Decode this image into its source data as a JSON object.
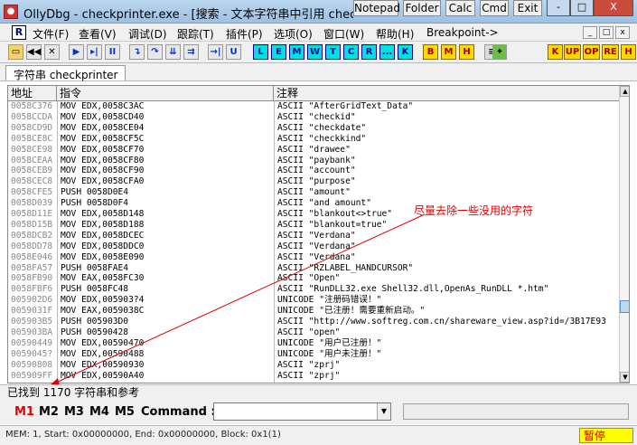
{
  "title": "OllyDbg - checkprinter.exe - [搜索 - 文本字符串中引用 checkprinter]",
  "external_buttons": [
    "Notepad",
    "Folder",
    "Calc",
    "Cmd",
    "Exit"
  ],
  "window_controls": {
    "minimize": "-",
    "maximize": "□",
    "close": "X"
  },
  "app_icon": "ollydbg-bug-icon",
  "menu": {
    "r_icon": "R",
    "items": [
      "文件(F)",
      "查看(V)",
      "调试(D)",
      "跟踪(T)",
      "插件(P)",
      "选项(O)",
      "窗口(W)",
      "帮助(H)",
      "Breakpoint->"
    ],
    "mdi_controls": [
      "_",
      "□",
      "x"
    ]
  },
  "toolbar": {
    "buttons": [
      "open",
      "rewind",
      "close",
      "run",
      "pause-run",
      "pause",
      "step-into",
      "step-over",
      "trace-into",
      "trace-over",
      "execute-till-return",
      "go-to-user"
    ],
    "letter_buttons": [
      "L",
      "E",
      "M",
      "W",
      "T",
      "C",
      "R",
      "...",
      "K"
    ],
    "letter_buttons2": [
      "B",
      "M",
      "H"
    ],
    "right_buttons": [
      "K",
      "UP",
      "OP",
      "RE",
      "H"
    ]
  },
  "tab": {
    "label": "字符串 checkprinter"
  },
  "table": {
    "headers": [
      "地址",
      "指令",
      "注释"
    ],
    "rows": [
      [
        "0058C376",
        "MOV EDX,0058C3AC",
        "ASCII \"AfterGridText_Data\""
      ],
      [
        "0058CCDA",
        "MOV EDX,0058CD40",
        "ASCII \"checkid\""
      ],
      [
        "0058CD9D",
        "MOV EDX,0058CE04",
        "ASCII \"checkdate\""
      ],
      [
        "0058CE8C",
        "MOV EDX,0058CF5C",
        "ASCII \"checkkind\""
      ],
      [
        "0058CE98",
        "MOV EDX,0058CF70",
        "ASCII \"drawee\""
      ],
      [
        "0058CEAA",
        "MOV EDX,0058CF80",
        "ASCII \"paybank\""
      ],
      [
        "0058CEB9",
        "MOV EDX,0058CF90",
        "ASCII \"account\""
      ],
      [
        "0058CEC8",
        "MOV EDX,0058CFA0",
        "ASCII \"purpose\""
      ],
      [
        "0058CFE5",
        "PUSH 0058D0E4",
        "ASCII \"amount\""
      ],
      [
        "0058D039",
        "PUSH 0058D0F4",
        "ASCII \"and amount\""
      ],
      [
        "0058D11E",
        "MOV EDX,0058D148",
        "ASCII \"blankout<>true\""
      ],
      [
        "0058D15B",
        "MOV EDX,0058D188",
        "ASCII \"blankout=true\""
      ],
      [
        "0058DCB2",
        "MOV EDX,0058DCEC",
        "ASCII \"Verdana\""
      ],
      [
        "0058DD78",
        "MOV EDX,0058DDC0",
        "ASCII \"Verdana\""
      ],
      [
        "0058E046",
        "MOV EDX,0058E090",
        "ASCII \"Verdana\""
      ],
      [
        "0058FA57",
        "PUSH 0058FAE4",
        "ASCII \"RZLABEL_HANDCURSOR\""
      ],
      [
        "0058FB90",
        "MOV EAX,0058FC30",
        "ASCII \"Open\""
      ],
      [
        "0058FBF6",
        "PUSH 0058FC48",
        "ASCII \"RunDLL32.exe Shell32.dll,OpenAs_RunDLL *.htm\""
      ],
      [
        "005902D6",
        "MOV EDX,005903?4",
        "UNICODE \"注册码错误！\""
      ],
      [
        "0059031F",
        "MOV EAX,0059038C",
        "UNICODE \"已注册！需要重新启动。\""
      ],
      [
        "005903B5",
        "PUSH 005903D0",
        "ASCII \"http://www.softreg.com.cn/shareware_view.asp?id=/3B17E93"
      ],
      [
        "005903BA",
        "PUSH 00590428",
        "ASCII \"open\""
      ],
      [
        "00590449",
        "MOV EDX,00590470",
        "UNICODE \"用户已注册！\""
      ],
      [
        "0059045?",
        "MOV EDX,00590488",
        "UNICODE \"用户未注册！\""
      ],
      [
        "00590808",
        "MOV EDX,00590930",
        "ASCII \"zprj\""
      ],
      [
        "005909FF",
        "MOV EDX,00590A40",
        "ASCII \"zprj\""
      ]
    ]
  },
  "annotation": "尽量去除一些没用的字符",
  "status_found": "已找到 1170 字符串和参考",
  "command_bar": {
    "m_buttons": [
      "M1",
      "M2",
      "M3",
      "M4",
      "M5"
    ],
    "command_label": "Command :",
    "command_value": ""
  },
  "statusbar": {
    "text": "MEM: 1, Start: 0x00000000, End: 0x00000000, Block: 0x1(1)",
    "state": "暂停"
  },
  "colors": {
    "accent_red": "#e00000",
    "title_bar": "#9cc0e3",
    "pause_bg": "#ffff00"
  }
}
